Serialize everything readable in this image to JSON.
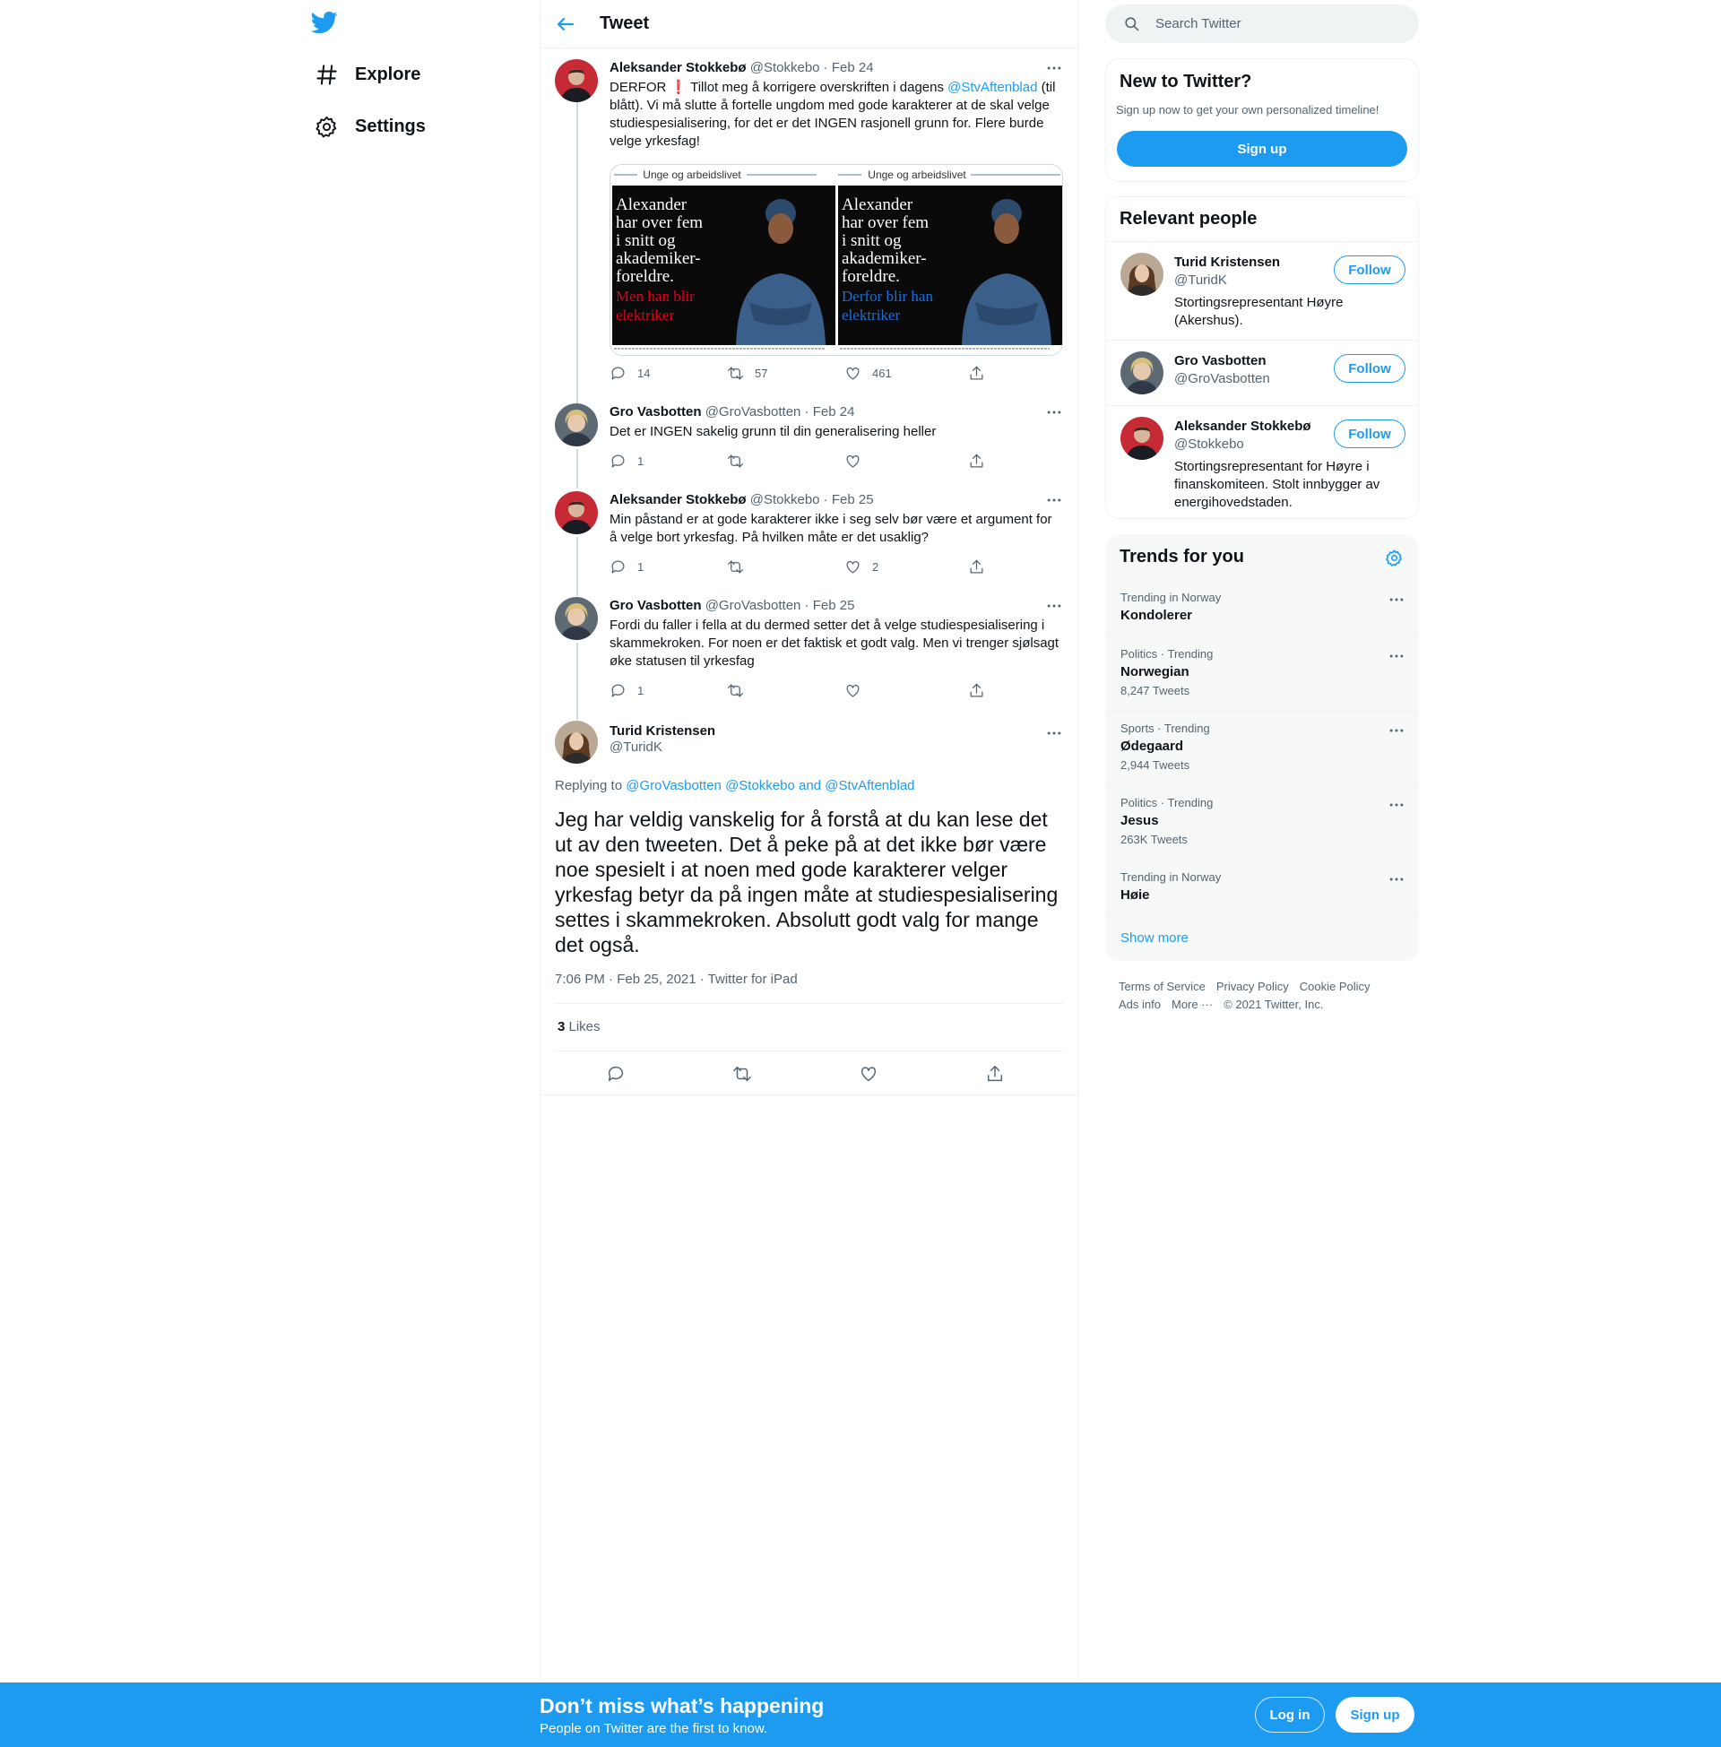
{
  "nav": {
    "explore_label": "Explore",
    "settings_label": "Settings"
  },
  "header": {
    "title": "Tweet"
  },
  "thread": [
    {
      "name": "Aleksander Stokkebø",
      "handle": "@Stokkebo",
      "date": "Feb 24",
      "text_a": "DERFOR ",
      "emoji": "❗",
      "text_b": " Tillot meg å korrigere overskriften i dagens ",
      "mention": "@StvAftenblad",
      "text_c": " (til blått). Vi må slutte å fortelle ungdom med gode karakterer at de skal velge studiespesialisering, for det er det INGEN rasjonell grunn for. Flere burde velge yrkesfag!",
      "replies": "14",
      "retweets": "57",
      "likes": "461",
      "media": {
        "header": "Unge og arbeidslivet",
        "headline": [
          "Alexander",
          "har over fem",
          "i snitt og",
          "akademiker-",
          "foreldre."
        ],
        "left_caption": [
          "Men han blir",
          "elektriker"
        ],
        "right_caption": [
          "Derfor blir han",
          "elektriker"
        ],
        "left_color": "#e0001b",
        "right_color": "#1d6fd6"
      }
    },
    {
      "name": "Gro Vasbotten",
      "handle": "@GroVasbotten",
      "date": "Feb 24",
      "text": "Det er INGEN sakelig grunn til din generalisering heller",
      "replies": "1",
      "retweets": "",
      "likes": ""
    },
    {
      "name": "Aleksander Stokkebø",
      "handle": "@Stokkebo",
      "date": "Feb 25",
      "text": "Min påstand er at gode karakterer ikke i seg selv bør være et argument for å velge bort yrkesfag. På hvilken måte er det usaklig?",
      "replies": "1",
      "retweets": "",
      "likes": "2"
    },
    {
      "name": "Gro Vasbotten",
      "handle": "@GroVasbotten",
      "date": "Feb 25",
      "text": "Fordi du faller i fella at du dermed setter det å velge studiespesialisering i skammekroken. For noen er det faktisk et godt valg. Men vi trenger sjølsagt øke statusen til yrkesfag",
      "replies": "1",
      "retweets": "",
      "likes": ""
    }
  ],
  "focal": {
    "name": "Turid Kristensen",
    "handle": "@TuridK",
    "replying_label": "Replying to ",
    "reply_m1": "@GroVasbotten",
    "reply_m2": "@Stokkebo",
    "reply_and": " and ",
    "reply_m3": "@StvAftenblad",
    "text": "Jeg har veldig vanskelig for å forstå at du kan lese det ut av den tweeten. Det å peke på at det ikke bør være noe spesielt i at noen med gode karakterer velger yrkesfag betyr da på ingen måte at studiespesialisering settes i skammekroken. Absolutt godt valg for mange det også.",
    "timestamp": "7:06 PM · Feb 25, 2021 · Twitter for iPad",
    "likes_count": "3",
    "likes_label": " Likes"
  },
  "search": {
    "placeholder": "Search Twitter"
  },
  "new_to_twitter": {
    "title": "New to Twitter?",
    "subtitle": "Sign up now to get your own personalized timeline!",
    "signup": "Sign up"
  },
  "relevant": {
    "title": "Relevant people",
    "follow_label": "Follow",
    "people": [
      {
        "name": "Turid Kristensen",
        "handle": "@TuridK",
        "bio": "Stortingsrepresentant Høyre (Akershus)."
      },
      {
        "name": "Gro Vasbotten",
        "handle": "@GroVasbotten",
        "bio": ""
      },
      {
        "name": "Aleksander Stokkebø",
        "handle": "@Stokkebo",
        "bio": "Stortingsrepresentant for Høyre i finanskomiteen. Stolt innbygger av energihovedstaden."
      }
    ]
  },
  "trends": {
    "title": "Trends for you",
    "items": [
      {
        "meta": "Trending in Norway",
        "name": "Kondolerer",
        "count": ""
      },
      {
        "meta": "Politics · Trending",
        "name": "Norwegian",
        "count": "8,247 Tweets"
      },
      {
        "meta": "Sports · Trending",
        "name": "Ødegaard",
        "count": "2,944 Tweets"
      },
      {
        "meta": "Politics · Trending",
        "name": "Jesus",
        "count": "263K Tweets"
      },
      {
        "meta": "Trending in Norway",
        "name": "Høie",
        "count": ""
      }
    ],
    "show_more": "Show more"
  },
  "footer": {
    "terms": "Terms of Service",
    "privacy": "Privacy Policy",
    "cookie": "Cookie Policy",
    "ads": "Ads info",
    "more": "More ···",
    "copyright": "© 2021 Twitter, Inc."
  },
  "banner": {
    "title": "Don’t miss what’s happening",
    "subtitle": "People on Twitter are the first to know.",
    "login": "Log in",
    "signup": "Sign up"
  },
  "colors": {
    "accent": "#1d9bf0",
    "text": "#0f1419",
    "muted": "#536471"
  }
}
